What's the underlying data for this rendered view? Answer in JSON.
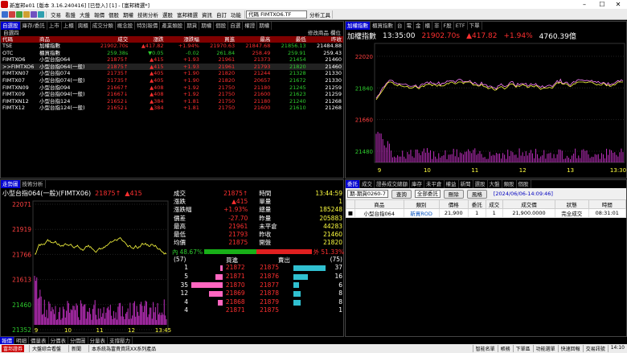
{
  "window": {
    "title": "新富邦e01 [版本 3.16.240416] [已登入] [1] - [富邦精選*]"
  },
  "toolbar": {
    "menus": [
      "交易",
      "看盤",
      "大盤",
      "報價",
      "個股",
      "期權",
      "技術分析",
      "選股",
      "富邦精選",
      "資訊",
      "自訂",
      "功能"
    ],
    "code_value": "代碼 FIMTXO6.TF",
    "analysis": "分析工具"
  },
  "quote_panel": {
    "tabs": [
      "自選股",
      "庫存/委託",
      "上市",
      "上櫃",
      "興櫃",
      "成交分類",
      "概念股",
      "特別報價",
      "產業類股",
      "期貨",
      "期權",
      "個股",
      "自選",
      "權證",
      "期權"
    ],
    "group": "自選四",
    "edit_label": "修改商品",
    "col_label": "欄位",
    "columns": [
      "代碼",
      "商品",
      "成交",
      "漲跌",
      "漲跌幅",
      "買進",
      "最高",
      "最低",
      "昨收"
    ],
    "rows": [
      {
        "code": "TSE",
        "name": "加權指數",
        "last": "21902.70s",
        "chg": "▲417.82",
        "pct": "+1.94%",
        "bid": "21970.63",
        "high": "21847.68",
        "low": "21856.13",
        "prev": "21484.88",
        "color": "r"
      },
      {
        "code": "OTC",
        "name": "櫃買指數",
        "last": "259.38s",
        "chg": "▼0.05",
        "pct": "-0.02",
        "bid": "261.84",
        "high": "258.49",
        "low": "259.91",
        "prev": "259.43",
        "color": "g"
      },
      {
        "code": "FIMTXO6",
        "name": "小型台指064",
        "last": "21875↑",
        "chg": "▲415",
        "pct": "+1.93",
        "bid": "21961",
        "high": "21373",
        "low": "21454",
        "prev": "21460",
        "color": "r"
      },
      {
        "code": ">>FIMTXO6",
        "name": "小型台指064(一般)",
        "last": "21875↑",
        "chg": "▲415",
        "pct": "+1.93",
        "bid": "21961",
        "high": "21793",
        "low": "21820",
        "prev": "21460",
        "color": "r"
      },
      {
        "code": "FIMTXN07",
        "name": "小型台指074",
        "last": "21735↑",
        "chg": "▲405",
        "pct": "+1.90",
        "bid": "21820",
        "high": "21244",
        "low": "21328",
        "prev": "21330",
        "color": "r"
      },
      {
        "code": "FIMTX07",
        "name": "小型台指074(一般)",
        "last": "21735↑",
        "chg": "▲405",
        "pct": "+1.90",
        "bid": "21820",
        "high": "20657",
        "low": "21672",
        "prev": "21330",
        "color": "r"
      },
      {
        "code": "FIMTXN09",
        "name": "小型台指094",
        "last": "21667↑",
        "chg": "▲408",
        "pct": "+1.92",
        "bid": "21750",
        "high": "21180",
        "low": "21245",
        "prev": "21259",
        "color": "r"
      },
      {
        "code": "FIMTX09",
        "name": "小型台指094(一般)",
        "last": "21667↓",
        "chg": "▲408",
        "pct": "+1.92",
        "bid": "21750",
        "high": "21600",
        "low": "21623",
        "prev": "21259",
        "color": "r"
      },
      {
        "code": "FIMTXN12",
        "name": "小型台指124",
        "last": "21652↓",
        "chg": "▲384",
        "pct": "+1.81",
        "bid": "21750",
        "high": "21180",
        "low": "21240",
        "prev": "21268",
        "color": "r"
      },
      {
        "code": "FIMTX12",
        "name": "小型台指124(一般)",
        "last": "21652↓",
        "chg": "▲384",
        "pct": "+1.81",
        "bid": "21750",
        "high": "21600",
        "low": "21610",
        "prev": "21268",
        "color": "r"
      }
    ]
  },
  "index_panel": {
    "tabs": [
      "加權指數",
      "櫃買指數",
      "台",
      "電",
      "金",
      "櫃",
      "非",
      "F股",
      "ETF",
      "下單"
    ],
    "name": "加權指數",
    "time": "13:35:00",
    "value": "21902.70s",
    "change": "▲417.82",
    "pct": "+1.94%",
    "volume": "4760.39億",
    "y_ticks": [
      "22020",
      "21840",
      "21660",
      "21480"
    ],
    "x_ticks": [
      "9",
      "10",
      "11",
      "12",
      "13",
      "13:30"
    ]
  },
  "futures_panel": {
    "tabs": [
      "走勢圖",
      "技術分析"
    ],
    "title": "小型台指064(一般)(FIMTX06)",
    "last": "21875↑",
    "change": "▲415",
    "y_ticks": [
      "22071",
      "21919",
      "21766",
      "21613",
      "21460",
      "21352"
    ],
    "x_ticks": [
      "9",
      "10",
      "11",
      "12",
      "13:45"
    ],
    "detail": [
      [
        "成交",
        "21875↑",
        "時間",
        "13:44:59"
      ],
      [
        "漲跌",
        "▲415",
        "單量",
        "1"
      ],
      [
        "漲跌幅",
        "+1.93%",
        "總量",
        "185248"
      ],
      [
        "價差",
        "-27.70",
        "昨量",
        "205883"
      ],
      [
        "最高",
        "21961",
        "未平倉",
        "44283"
      ],
      [
        "最低",
        "21793",
        "昨收",
        "21460"
      ],
      [
        "均價",
        "21875",
        "開盤",
        "21820"
      ]
    ],
    "inner_pct": "48.67%",
    "inner_label": "內",
    "outer_label": "外",
    "outer_pct": "51.33%",
    "bid_total": "(57)",
    "ask_total": "(75)",
    "book_headers": [
      "買進",
      "賣出"
    ],
    "book": [
      {
        "bq": "1",
        "bp": "21872",
        "ap": "21875",
        "aq": "37",
        "bw": 5,
        "aw": 70
      },
      {
        "bq": "5",
        "bp": "21871",
        "ap": "21876",
        "aq": "16",
        "bw": 15,
        "aw": 30
      },
      {
        "bq": "35",
        "bp": "21870",
        "ap": "21877",
        "aq": "6",
        "bw": 68,
        "aw": 12
      },
      {
        "bq": "12",
        "bp": "21869",
        "ap": "21878",
        "aq": "8",
        "bw": 30,
        "aw": 15
      },
      {
        "bq": "4",
        "bp": "21868",
        "ap": "21879",
        "aq": "8",
        "bw": 10,
        "aw": 15
      }
    ],
    "book_footer": {
      "bq": "4",
      "bp": "21871",
      "ap": "21875",
      "aq": "1"
    }
  },
  "order_panel": {
    "tabs": [
      "委託",
      "成交",
      "證券成交總額",
      "庫存",
      "未平倉",
      "權益",
      "新聞",
      "選股",
      "大盤",
      "類股",
      "個股"
    ],
    "account": "期-期貨0260-7",
    "query": "查詢",
    "filter": "全部委託",
    "delete": "刪除",
    "risk": "風格",
    "timestamp": "[2024/06/06-14:09:46]",
    "columns": [
      "",
      "商品",
      "類別",
      "價格",
      "委託",
      "成交",
      "成交價",
      "狀態",
      "時間"
    ],
    "rows": [
      {
        "mark": "■",
        "product": "小型台指064",
        "type": "新買ROD",
        "price": "21,900",
        "qty": "1",
        "filled": "1",
        "fill_price": "21,900.0000",
        "status": "完全成交",
        "time": "08:31:01"
      }
    ]
  },
  "bottom_tabs": [
    "報價",
    "明細",
    "價量表",
    "分價表",
    "分價圖",
    "分量表",
    "支撐壓力"
  ],
  "statusbar": {
    "live": "富邦證券",
    "items": [
      "大盤綜合看盤",
      "新聞",
      "本系統為富貴資訊XX系列產品"
    ],
    "right": [
      "智能名單",
      "帳務",
      "下單區",
      "功能選單",
      "快速回報",
      "交易訊號",
      "14:10"
    ]
  }
}
